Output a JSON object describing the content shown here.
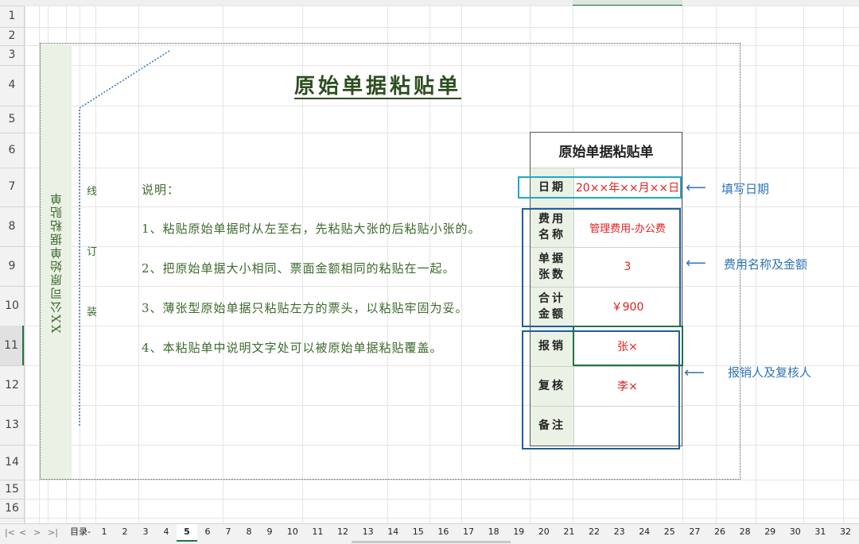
{
  "row_headers": [
    "1",
    "2",
    "3",
    "4",
    "5",
    "6",
    "7",
    "8",
    "9",
    "10",
    "11",
    "12",
    "13",
    "14",
    "15",
    "16"
  ],
  "active_row": "11",
  "side_title": "XX公司原始单据粘贴单",
  "binding_chars": [
    "线",
    "订",
    "装"
  ],
  "main_title": "原始单据粘贴单",
  "notes": {
    "heading": "说明：",
    "items": [
      "1、粘贴原始单据时从左至右，先粘贴大张的后粘贴小张的。",
      "2、把原始单据大小相同、票面金额相同的粘贴在一起。",
      "3、薄张型原始单据只粘贴左方的票头，以粘贴牢固为妥。",
      "4、本粘贴单中说明文字处可以被原始单据粘贴覆盖。"
    ]
  },
  "form": {
    "title": "原始单据粘贴单",
    "date_label": "日期",
    "date_value": "20××年××月××日",
    "expense_name_label_1": "费用",
    "expense_name_label_2": "名称",
    "expense_name_value": "管理费用-办公费",
    "doc_count_label_1": "单据",
    "doc_count_label_2": "张数",
    "doc_count_value": "3",
    "total_label_1": "合计",
    "total_label_2": "金额",
    "total_value": "￥900",
    "reimburse_label": "报销",
    "reimburse_value": "张×",
    "review_label": "复核",
    "review_value": "李×",
    "remark_label": "备注",
    "remark_value": ""
  },
  "annotations": {
    "date": "填写日期",
    "expense": "费用名称及金额",
    "people": "报销人及复核人"
  },
  "sheet_tabs": {
    "nav": [
      "|<",
      "<",
      ">",
      ">|"
    ],
    "items": [
      "目录-",
      "1",
      "2",
      "3",
      "4",
      "5",
      "6",
      "7",
      "8",
      "9",
      "10",
      "11",
      "12",
      "13",
      "14",
      "15",
      "16",
      "17",
      "18",
      "19",
      "20",
      "21",
      "22",
      "23",
      "24",
      "25",
      "27",
      "26",
      "28",
      "29",
      "30",
      "31",
      "32"
    ],
    "active": "5"
  },
  "colors": {
    "accent": "#217346",
    "label_green": "#3c6a2b",
    "value_red": "#e02020",
    "annotation_blue": "#2e75b6",
    "box_teal": "#1fa8c9",
    "box_navy": "#1f5f9e"
  }
}
